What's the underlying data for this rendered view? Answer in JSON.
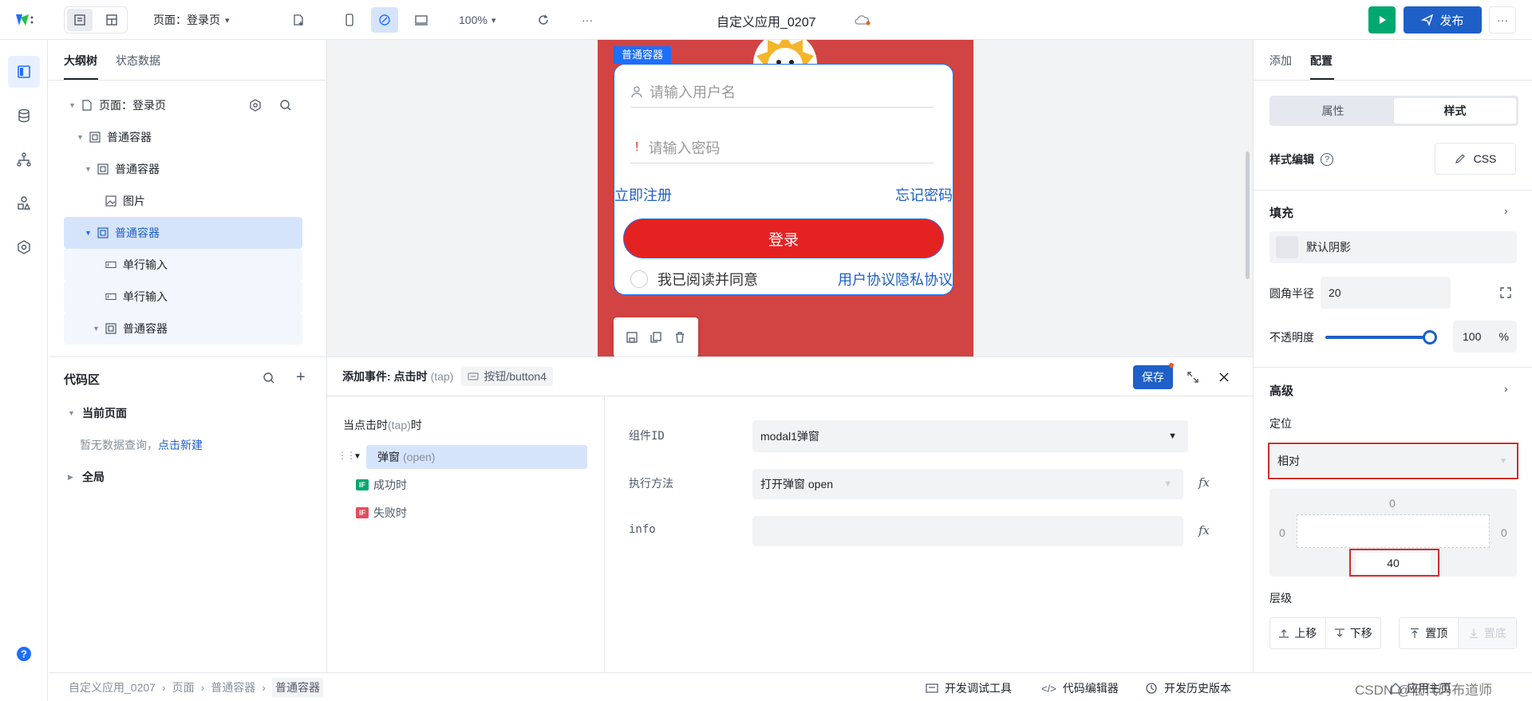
{
  "topbar": {
    "page_selector": "页面：登录页",
    "zoom": "100%",
    "app_title": "自定义应用_0207",
    "publish_label": "发布",
    "more_label": "···"
  },
  "outline": {
    "tabs": [
      "大纲树",
      "状态数据"
    ],
    "items": [
      {
        "label": "页面：登录页"
      },
      {
        "label": "普通容器"
      },
      {
        "label": "普通容器"
      },
      {
        "label": "图片"
      },
      {
        "label": "普通容器"
      },
      {
        "label": "单行输入"
      },
      {
        "label": "单行输入"
      },
      {
        "label": "普通容器"
      }
    ]
  },
  "codearea": {
    "title": "代码区",
    "current_page": "当前页面",
    "empty_text": "暂无数据查询，",
    "create_link": "点击新建",
    "global": "全局"
  },
  "canvas": {
    "container_tag": "普通容器",
    "username_placeholder": "请输入用户名",
    "password_placeholder": "请输入密码",
    "register_link": "立即注册",
    "forgot_link": "忘记密码",
    "login_button": "登录",
    "agree_text": "我已阅读并同意",
    "agreement_links": "用户协议隐私协议",
    "colors": {
      "background": "#d24343",
      "primary": "#e52222",
      "link": "#1e5fc8",
      "selection": "#1e6fff"
    }
  },
  "event": {
    "header_prefix": "添加事件: 点击时",
    "header_tap": "(tap)",
    "component": "按钮/button4",
    "save_label": "保存",
    "trigger_title_a": "当点击时",
    "trigger_title_b": "(tap)",
    "trigger_title_c": "时",
    "action_label": "弹窗",
    "action_method": "(open)",
    "success_label": "成功时",
    "fail_label": "失败时",
    "if_badge": "IF",
    "form": {
      "component_id_label": "组件ID",
      "component_id_value": "modal1弹窗",
      "method_label": "执行方法",
      "method_value": "打开弹窗 open",
      "info_label": "info",
      "info_value": ""
    }
  },
  "config": {
    "tabs": [
      "添加",
      "配置"
    ],
    "segment": [
      "属性",
      "样式"
    ],
    "style_edit_label": "样式编辑",
    "css_button": "CSS",
    "fill_label": "填充",
    "default_shadow": "默认阴影",
    "radius_label": "圆角半径",
    "radius_value": "20",
    "opacity_label": "不透明度",
    "opacity_value": "100",
    "opacity_unit": "%",
    "opacity_level": 1.0,
    "advanced_label": "高级",
    "position_label": "定位",
    "position_value": "相对",
    "offset_top": "0",
    "offset_left": "0",
    "offset_right": "0",
    "offset_bottom": "40",
    "layer_label": "层级",
    "move_up": "上移",
    "move_down": "下移",
    "to_top": "置顶",
    "to_bottom": "置底"
  },
  "statusbar": {
    "crumbs": [
      "自定义应用_0207",
      "页面",
      "普通容器",
      "普通容器"
    ],
    "debug_tool": "开发调试工具",
    "code_editor": "代码编辑器",
    "history": "开发历史版本",
    "app_home": "应用主页",
    "watermark": "CSDN @低代码布道师"
  }
}
